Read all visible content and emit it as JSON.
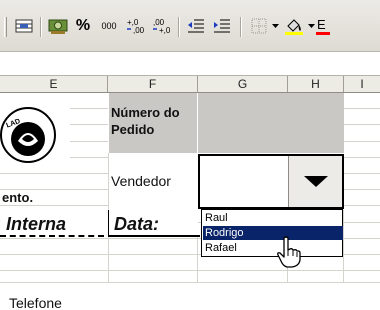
{
  "toolbar": {
    "percent_label": "%",
    "thousands_label": "000",
    "increase_decimal_label": "+,0 ,00",
    "decrease_decimal_label": ",00 +,0",
    "colors": {
      "fill_color": "#ffff00",
      "font_color": "#ff0000"
    }
  },
  "columns": [
    "E",
    "F",
    "G",
    "H",
    "I"
  ],
  "cells": {
    "numero_pedido": "Número do Pedido",
    "vendedor_label": "Vendedor",
    "ento_fragment": "ento.",
    "interna_fragment": "Interna",
    "data_label": "Data:",
    "telefone_label": "Telefone"
  },
  "dropdown": {
    "selected_value": "",
    "options": [
      "Raul",
      "Rodrigo",
      "Rafael"
    ],
    "highlighted_index": 1
  },
  "logo": {
    "text": "LAD"
  },
  "colors": {
    "header_fill": "#c9c8c5",
    "selection": "#0a246a"
  }
}
